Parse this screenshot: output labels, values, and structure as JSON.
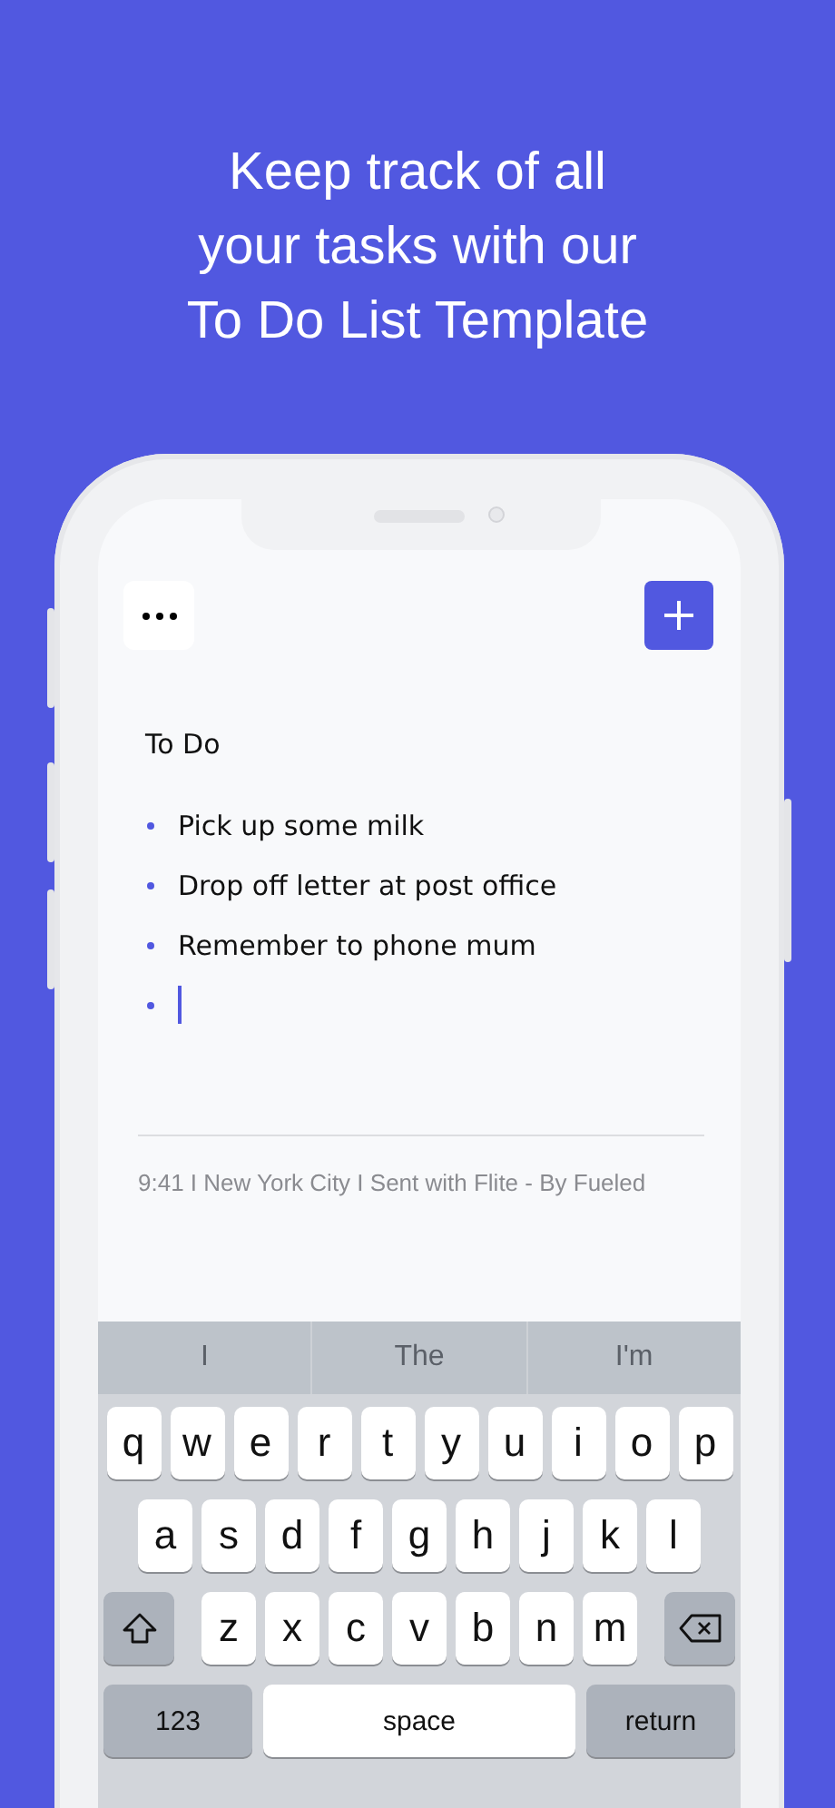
{
  "headline_lines": [
    "Keep track of all",
    "your tasks with our",
    "To Do List Template"
  ],
  "note": {
    "title": "To Do",
    "items": [
      "Pick up some milk",
      "Drop off letter at post office",
      "Remember to phone mum"
    ],
    "new_item": {
      "focused": true
    }
  },
  "footer": "9:41 I New York City I Sent with Flite - By Fueled",
  "keyboard": {
    "suggestions": [
      "I",
      "The",
      "I'm"
    ],
    "rows": [
      [
        "q",
        "w",
        "e",
        "r",
        "t",
        "y",
        "u",
        "i",
        "o",
        "p"
      ],
      [
        "a",
        "s",
        "d",
        "f",
        "g",
        "h",
        "j",
        "k",
        "l"
      ],
      [
        "z",
        "x",
        "c",
        "v",
        "b",
        "n",
        "m"
      ]
    ],
    "numbers_key": "123",
    "space_key": "space",
    "return_key": "return"
  }
}
